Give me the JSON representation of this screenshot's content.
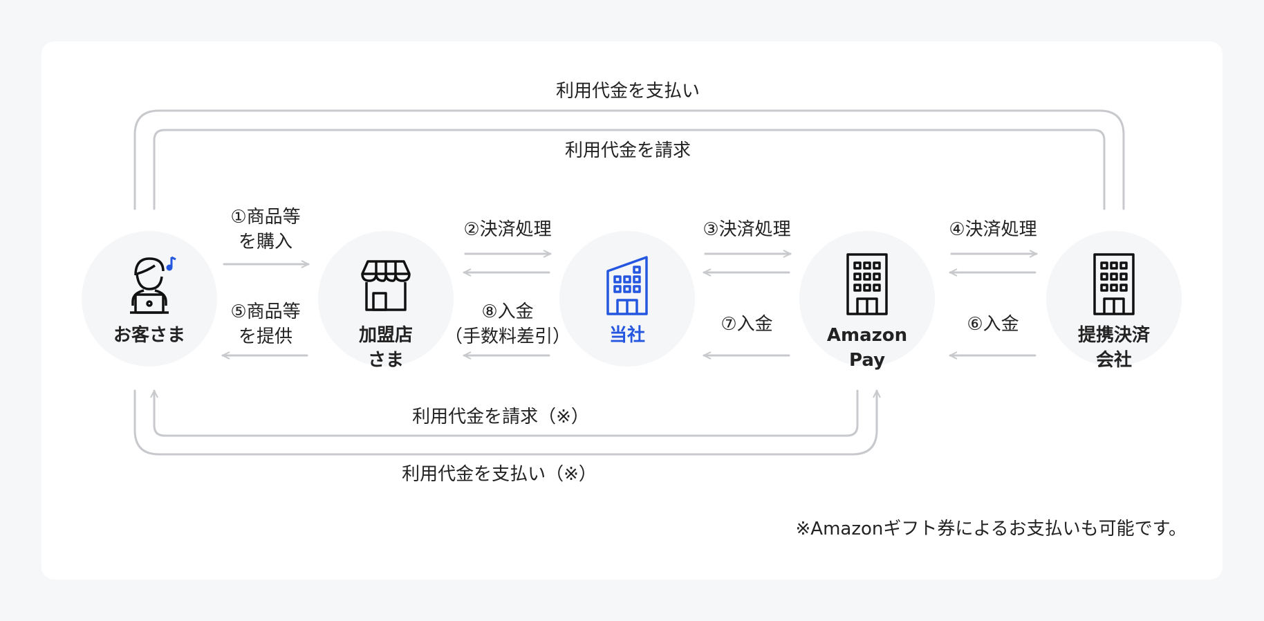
{
  "colors": {
    "accent": "#2456e0",
    "line": "#c7c9cc",
    "node_bg": "#f5f6f8"
  },
  "nodes": {
    "customer": {
      "name": "お客さま",
      "icon": "person-with-laptop-icon"
    },
    "merchant": {
      "name": "加盟店\nさま",
      "icon": "storefront-icon"
    },
    "company": {
      "name": "当社",
      "icon": "office-building-icon"
    },
    "amazon": {
      "name": "Amazon\nPay",
      "icon": "office-building-icon"
    },
    "payment": {
      "name": "提携決済\n会社",
      "icon": "office-building-icon"
    }
  },
  "flows": {
    "f1": "①商品等\nを購入",
    "f5": "⑤商品等\nを提供",
    "f2": "②決済処理",
    "f8": "⑧入金\n（手数料差引）",
    "f3": "③決済処理",
    "f7": "⑦入金",
    "f4": "④決済処理",
    "f6": "⑥入金"
  },
  "loops": {
    "top_outer": "利用代金を支払い",
    "top_inner": "利用代金を請求",
    "bottom_inner": "利用代金を請求（※）",
    "bottom_outer": "利用代金を支払い（※）"
  },
  "note": "※Amazonギフト券によるお支払いも可能です。"
}
